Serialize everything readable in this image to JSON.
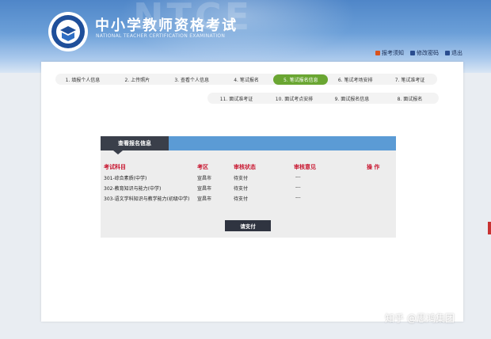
{
  "header": {
    "title_cn": "中小学教师资格考试",
    "title_en": "NATIONAL TEACHER CERTIFICATION EXAMINATION",
    "links": [
      {
        "label": "报考须知",
        "icon": "info-icon",
        "color": "#d9531e"
      },
      {
        "label": "修改密码",
        "icon": "key-icon",
        "color": "#2a4d8f"
      },
      {
        "label": "退出",
        "icon": "logout-icon",
        "color": "#2a4d8f"
      }
    ]
  },
  "steps_row1": [
    {
      "label": "1. 填报个人信息",
      "active": false
    },
    {
      "label": "2. 上传照片",
      "active": false
    },
    {
      "label": "3. 查看个人信息",
      "active": false
    },
    {
      "label": "4. 笔试报名",
      "active": false
    },
    {
      "label": "5. 笔试报名信息",
      "active": true
    },
    {
      "label": "6. 笔试考场安排",
      "active": false
    },
    {
      "label": "7. 笔试准考证",
      "active": false
    }
  ],
  "steps_row2": [
    {
      "label": "11. 面试准考证",
      "active": false
    },
    {
      "label": "10. 面试考点安排",
      "active": false
    },
    {
      "label": "9. 面试报名信息",
      "active": false
    },
    {
      "label": "8. 面试报名",
      "active": false
    }
  ],
  "info": {
    "tab_title": "查看报名信息",
    "headers": [
      "考试科目",
      "考区",
      "审核状态",
      "审核意见",
      "操 作"
    ],
    "rows": [
      [
        "301-综合素质(中学)",
        "宣昌市",
        "待支付",
        "---",
        ""
      ],
      [
        "302-教育知识与能力(中学)",
        "宣昌市",
        "待支付",
        "---",
        ""
      ],
      [
        "303-语文学科知识与教学能力(初级中学)",
        "宣昌市",
        "待支付",
        "---",
        ""
      ]
    ],
    "pay_label": "请支付"
  },
  "watermark": {
    "bg_text": "NTCE",
    "site": "知乎 @思鸿集团"
  }
}
